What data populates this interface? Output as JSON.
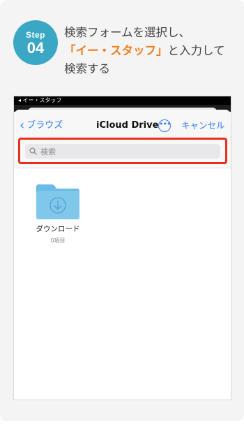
{
  "step": {
    "word": "Step",
    "number": "04"
  },
  "instruction": {
    "line1": "検索フォームを選択し、",
    "highlight": "「イー・スタッフ」",
    "line2_rest": "と入力して",
    "line3": "検索する"
  },
  "phone": {
    "status_text": "◂ イー・スタッフ",
    "nav": {
      "back_label": "ブラウズ",
      "title": "iCloud Drive",
      "cancel_label": "キャンセル"
    },
    "search": {
      "placeholder": "検索"
    },
    "folder": {
      "name": "ダウンロード",
      "count": "0項目"
    }
  },
  "colors": {
    "badge": "#3aa8c4",
    "highlight_text": "#f07c1a",
    "ios_blue": "#2f7cf6",
    "red_frame": "#e6301b",
    "folder": "#7fc8ec"
  }
}
